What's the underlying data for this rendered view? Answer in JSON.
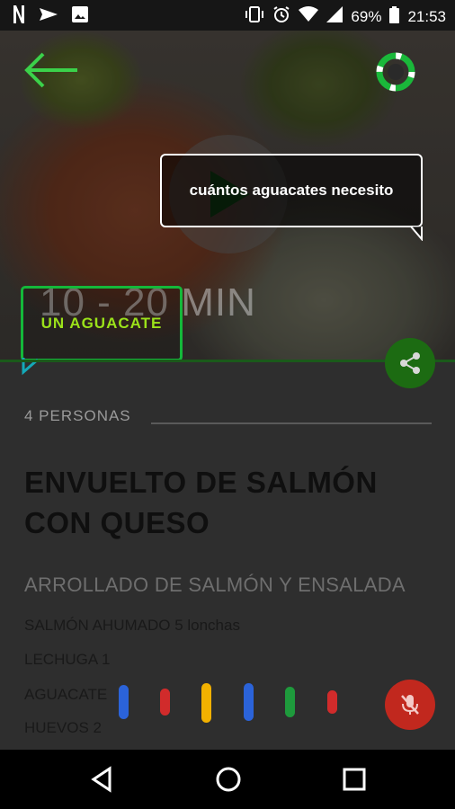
{
  "status_bar": {
    "left_icons": [
      "netflix-icon",
      "send-icon",
      "image-icon"
    ],
    "right_icons": [
      "vibrate-icon",
      "alarm-icon",
      "wifi-icon",
      "signal-icon"
    ],
    "battery": "69%",
    "time": "21:53"
  },
  "hero": {
    "time_label": "10 - 20 MIN",
    "assistant_query": "cuántos aguacates necesito",
    "answer_badge": "UN  AGUACATE"
  },
  "recipe": {
    "persons": "4 PERSONAS",
    "title_line1": "ENVUELTO DE SALMÓN",
    "title_line2": "CON QUESO",
    "subtitle": "ARROLLADO DE SALMÓN Y ENSALADA",
    "ingredients": [
      "SALMÓN AHUMADO 5 lonchas",
      "LECHUGA 1",
      "AGUACATE",
      "HUEVOS 2"
    ]
  },
  "colors": {
    "accent_green": "#14b83a",
    "badge_text": "#9be21a",
    "mic_red": "#c1281e",
    "voice_blue": "#2b63d9",
    "voice_red": "#d12b2b",
    "voice_yellow": "#f2b100",
    "voice_green": "#1e9a3c"
  },
  "nav_bar": {
    "buttons": [
      "back-icon",
      "home-icon",
      "recents-icon"
    ]
  }
}
